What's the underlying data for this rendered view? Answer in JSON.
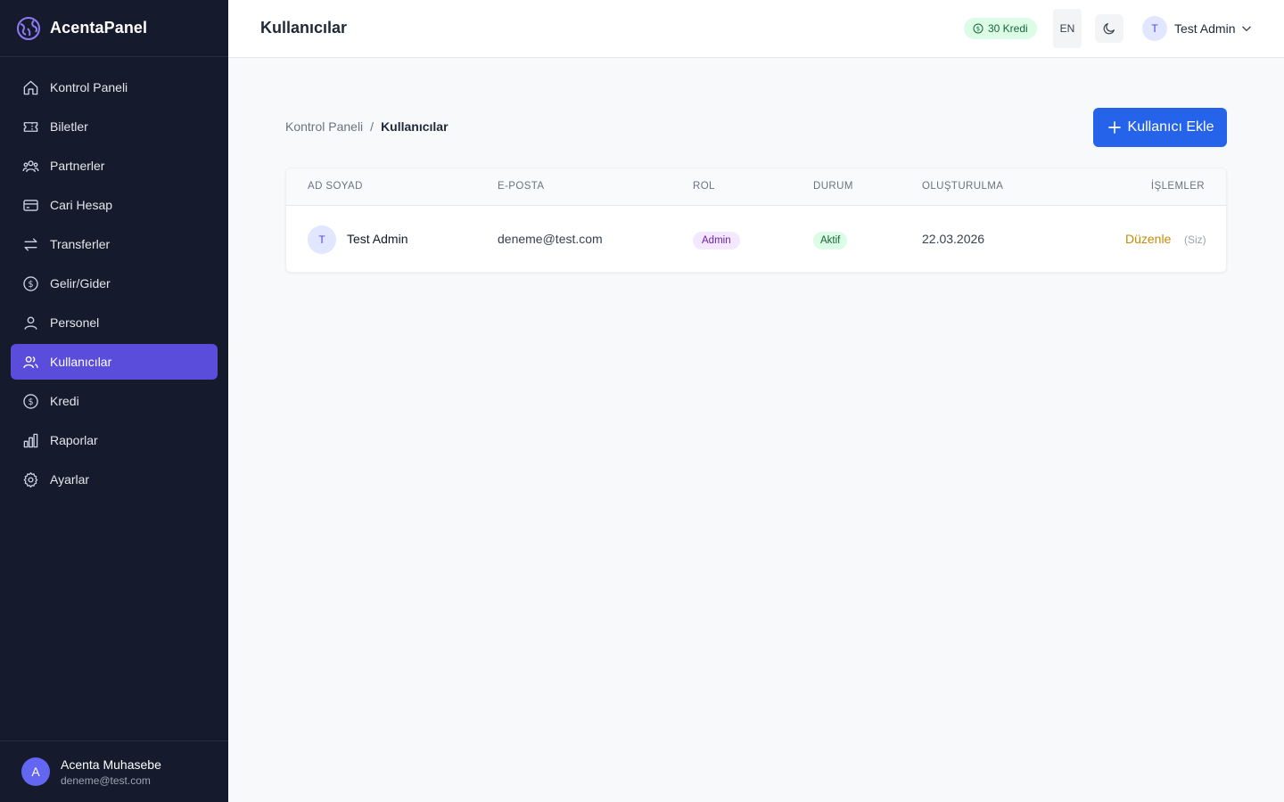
{
  "app": {
    "name": "AcentaPanel"
  },
  "sidebar": {
    "items": [
      {
        "label": "Kontrol Paneli",
        "icon": "home-icon"
      },
      {
        "label": "Biletler",
        "icon": "ticket-icon"
      },
      {
        "label": "Partnerler",
        "icon": "users-group-icon"
      },
      {
        "label": "Cari Hesap",
        "icon": "credit-card-icon"
      },
      {
        "label": "Transferler",
        "icon": "arrows-exchange-icon"
      },
      {
        "label": "Gelir/Gider",
        "icon": "dollar-circle-icon"
      },
      {
        "label": "Personel",
        "icon": "user-icon"
      },
      {
        "label": "Kullanıcılar",
        "icon": "users-icon",
        "active": true
      },
      {
        "label": "Kredi",
        "icon": "dollar-circle-icon"
      },
      {
        "label": "Raporlar",
        "icon": "bar-chart-icon"
      },
      {
        "label": "Ayarlar",
        "icon": "gear-icon"
      }
    ],
    "footer": {
      "avatar_initial": "A",
      "name": "Acenta Muhasebe",
      "email": "deneme@test.com"
    }
  },
  "header": {
    "title": "Kullanıcılar",
    "credit": "30 Kredi",
    "lang": "EN",
    "user_initial": "T",
    "user_name": "Test Admin"
  },
  "breadcrumb": {
    "parent": "Kontrol Paneli",
    "separator": "/",
    "current": "Kullanıcılar"
  },
  "actions": {
    "add_user": "Kullanıcı Ekle"
  },
  "table": {
    "columns": [
      "AD SOYAD",
      "E-POSTA",
      "ROL",
      "DURUM",
      "OLUŞTURULMA",
      "İŞLEMLER"
    ],
    "rows": [
      {
        "initial": "T",
        "name": "Test Admin",
        "email": "deneme@test.com",
        "role": "Admin",
        "status": "Aktif",
        "created": "22.03.2026",
        "action": "Düzenle",
        "note": "(Siz)"
      }
    ]
  },
  "colors": {
    "sidebar_bg": "#151b2c",
    "active_nav": "#5b4ddb",
    "primary": "#2563eb",
    "edit_link": "#ca8a04"
  }
}
